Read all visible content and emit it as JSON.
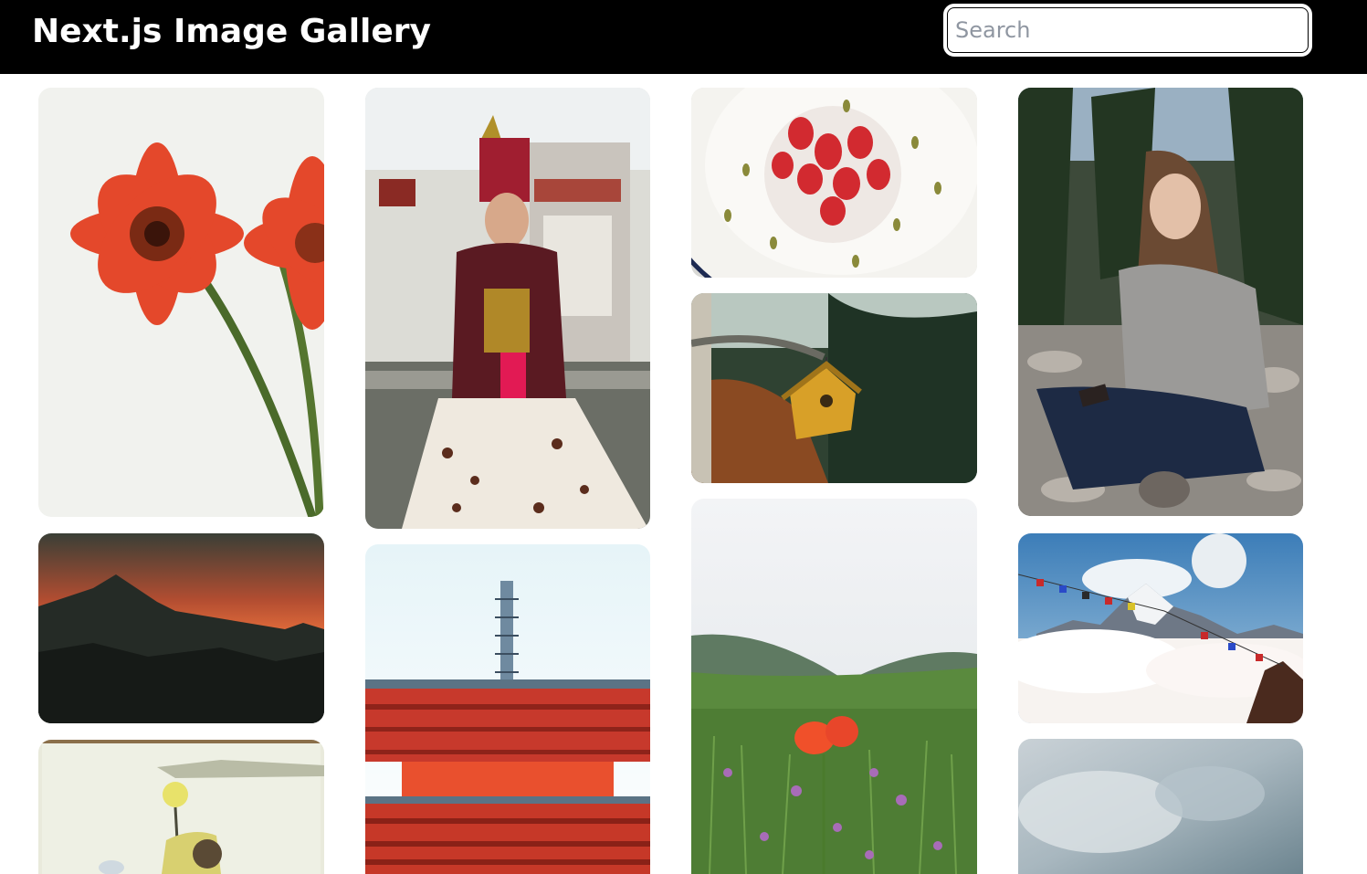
{
  "header": {
    "title": "Next.js Image Gallery",
    "search_placeholder": "Search"
  },
  "gallery": {
    "images": [
      {
        "icon": "red-gerbera-flowers-image"
      },
      {
        "icon": "traditional-dancer-costume-image"
      },
      {
        "icon": "strawberry-dessert-plate-image"
      },
      {
        "icon": "woman-sitting-forest-image"
      },
      {
        "icon": "yellow-birdhouse-branch-image"
      },
      {
        "icon": "mountain-silhouette-sunset-image"
      },
      {
        "icon": "red-pagoda-temple-image"
      },
      {
        "icon": "poppy-meadow-hills-image"
      },
      {
        "icon": "snowy-mountain-prayer-flags-image"
      },
      {
        "icon": "misty-riverside-scooter-image"
      },
      {
        "icon": "cloudy-blue-sky-image"
      }
    ]
  },
  "colors": {
    "header_bg": "#000000",
    "page_bg": "#ffffff"
  }
}
